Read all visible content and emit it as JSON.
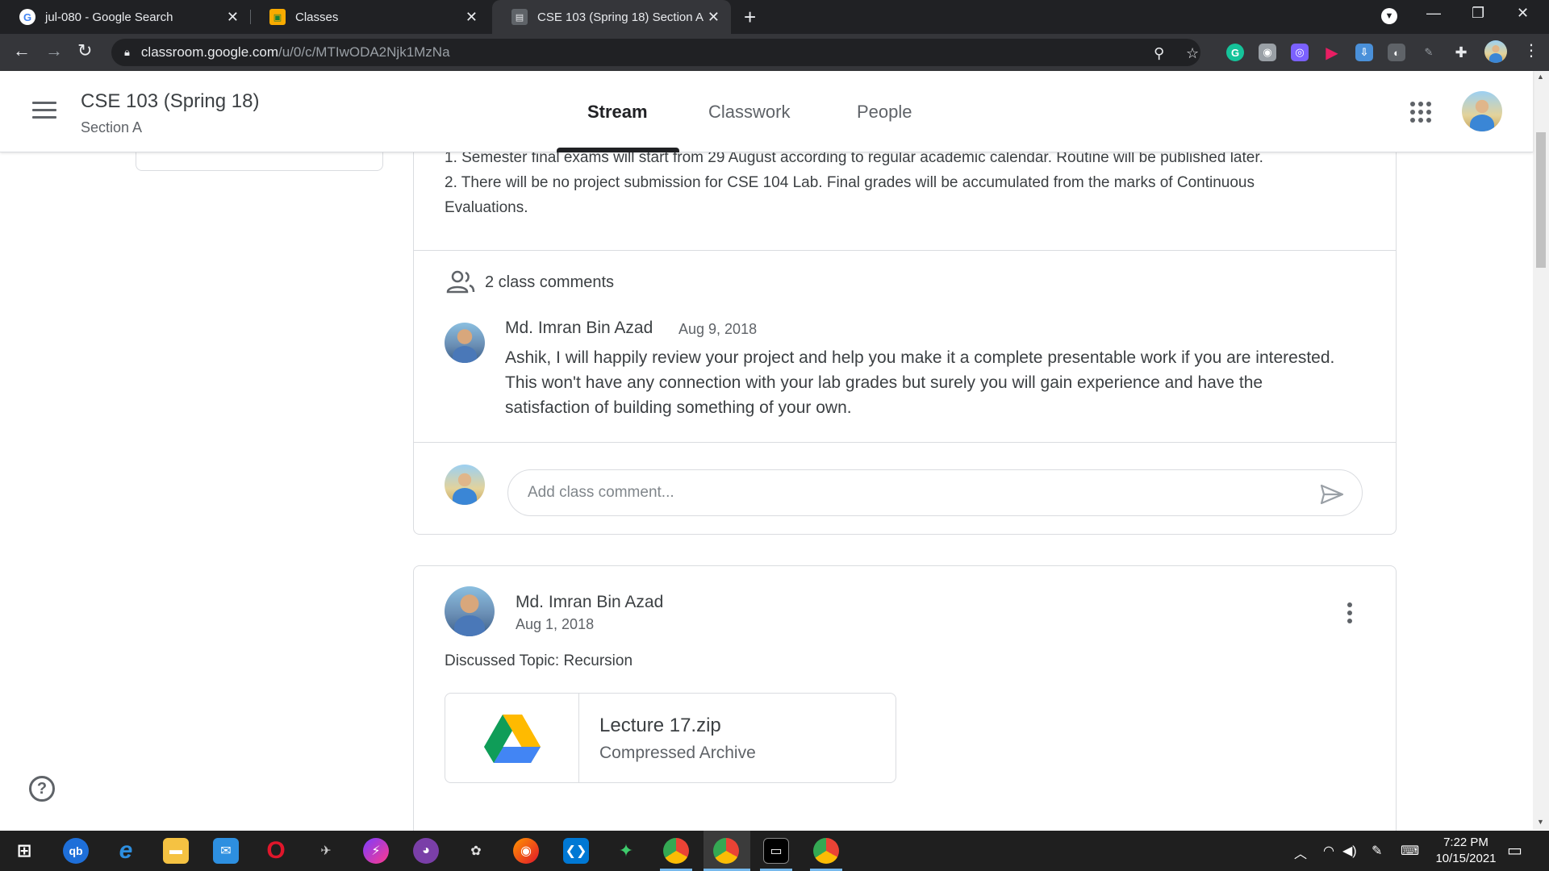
{
  "browser": {
    "tabs": [
      {
        "title": "jul-080 - Google Search",
        "favicon": "google-icon",
        "active": false
      },
      {
        "title": "Classes",
        "favicon": "classroom-icon",
        "active": false
      },
      {
        "title": "CSE 103 (Spring 18) Section A",
        "favicon": "classroom-icon",
        "active": true
      }
    ],
    "url_host": "classroom.google.com",
    "url_path": "/u/0/c/MTIwODA2Njk1MzNa"
  },
  "header": {
    "class_title": "CSE 103 (Spring 18)",
    "class_section": "Section A",
    "tabs": [
      {
        "label": "Stream",
        "active": true
      },
      {
        "label": "Classwork",
        "active": false
      },
      {
        "label": "People",
        "active": false
      }
    ]
  },
  "announcement": {
    "line1": "1. Semester final exams will start from 29 August according to regular academic calendar. Routine will be published later.",
    "line2": "2. There will be no project submission for CSE 104 Lab. Final grades will be accumulated from the marks of Continuous",
    "line3": "Evaluations.",
    "comments_count_label": "2 class comments",
    "comment": {
      "author": "Md. Imran Bin Azad",
      "date": "Aug 9, 2018",
      "text": "Ashik, I will happily review your project and help you make it a complete presentable work if you are interested. This won't have any connection with your lab grades but surely you will gain experience and have the satisfaction of building something of your own."
    },
    "comment_placeholder": "Add class comment..."
  },
  "post": {
    "author": "Md. Imran Bin Azad",
    "date": "Aug 1, 2018",
    "text": "Discussed Topic: Recursion",
    "attachment": {
      "title": "Lecture 17.zip",
      "subtitle": "Compressed Archive",
      "icon": "google-drive-icon"
    }
  },
  "taskbar": {
    "time": "7:22 PM",
    "date": "10/15/2021"
  },
  "colors": {
    "chrome_dark": "#202124",
    "chrome_tab_active": "#35363a",
    "text_primary": "#3c4043",
    "text_secondary": "#5f6368",
    "border": "#dadce0"
  }
}
